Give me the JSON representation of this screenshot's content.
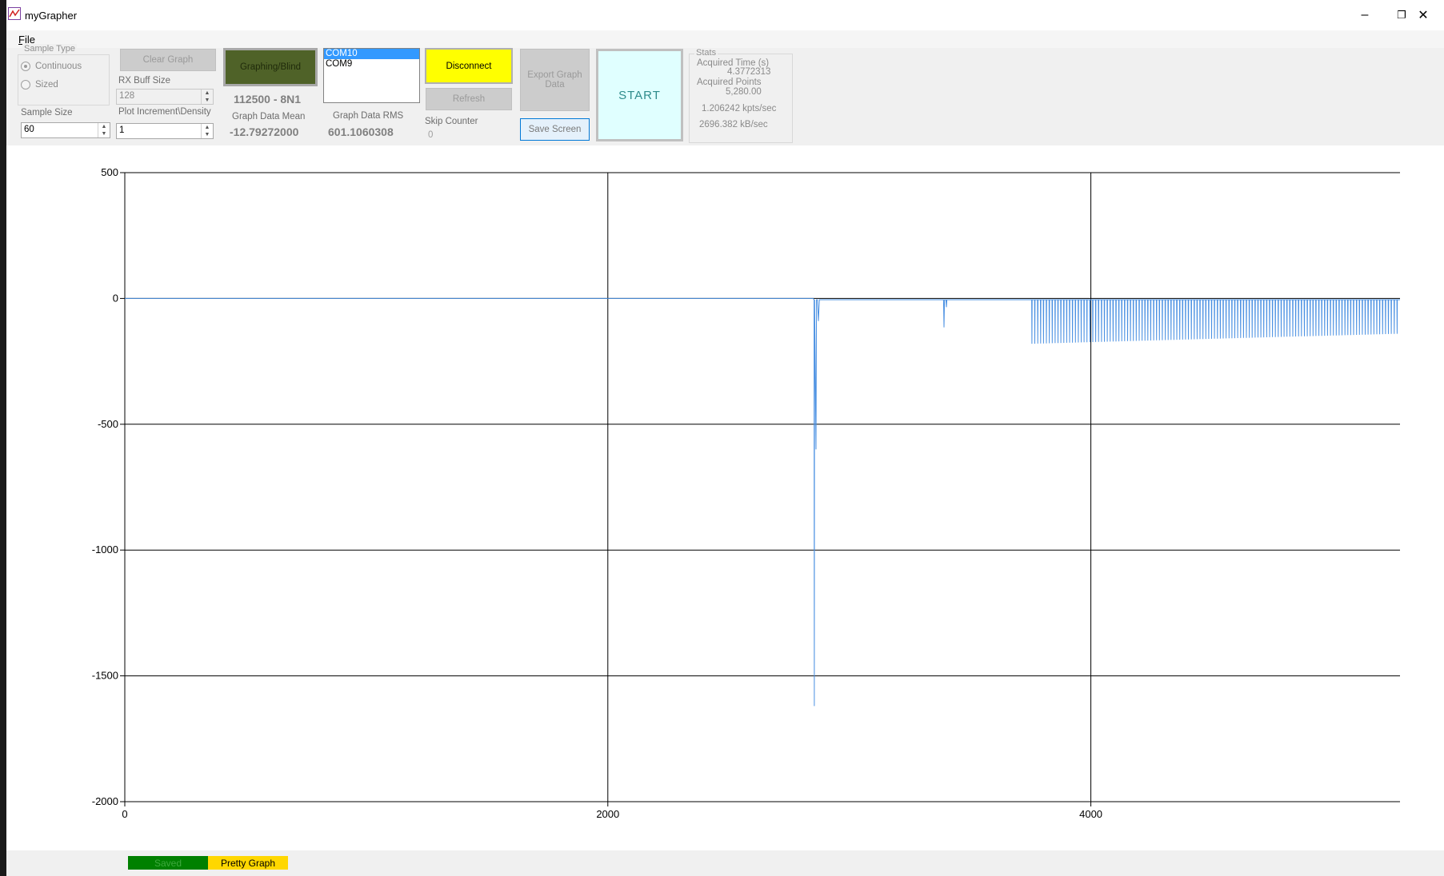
{
  "window": {
    "title": "myGrapher",
    "controls": {
      "minimize": "–",
      "restore": "❐",
      "close": "✕"
    }
  },
  "menu": {
    "file_label": "File"
  },
  "sample_type": {
    "legend": "Sample Type",
    "options": [
      "Continuous",
      "Sized"
    ],
    "selected": "Continuous"
  },
  "sample_size": {
    "label": "Sample Size",
    "value": "60"
  },
  "clear_graph": {
    "label": "Clear Graph"
  },
  "rx_buff": {
    "label": "RX Buff Size",
    "value": "128"
  },
  "plot_increment": {
    "label": "Plot Increment\\Density",
    "value": "1"
  },
  "graphing_blind": {
    "label": "Graphing/Blind",
    "color": "#4f6228"
  },
  "serial_config": "112500 - 8N1",
  "graph_mean": {
    "label": "Graph Data Mean",
    "value": "-12.79272000"
  },
  "graph_rms": {
    "label": "Graph Data RMS",
    "value": "601.1060308"
  },
  "ports": {
    "items": [
      "COM10",
      "COM9"
    ],
    "selected": "COM10"
  },
  "disconnect": {
    "label": "Disconnect",
    "color": "#ffff00"
  },
  "refresh": {
    "label": "Refresh"
  },
  "skip_counter": {
    "label": "Skip Counter",
    "value": "0"
  },
  "export": {
    "label": "Export Graph Data"
  },
  "save_screen": {
    "label": "Save Screen"
  },
  "start": {
    "label": "START",
    "color": "#e0ffff",
    "text_color": "#2e8b8b"
  },
  "stats": {
    "legend": "Stats",
    "acquired_time_label": "Acquired Time (s)",
    "acquired_time_value": "4.3772313",
    "acquired_points_label": "Acquired Points",
    "acquired_points_value": "5,280.00",
    "kpts_rate": "1.206242 kpts/sec",
    "kb_rate": "2696.382 kB/sec"
  },
  "chart_data": {
    "type": "line",
    "title": "",
    "xlabel": "",
    "ylabel": "",
    "xlim": [
      0,
      5280
    ],
    "ylim": [
      -2000,
      500
    ],
    "x_ticks": [
      0,
      2000,
      4000
    ],
    "y_ticks": [
      500,
      0,
      -500,
      -1000,
      -1500,
      -2000
    ],
    "grid": true,
    "series_color": "#4a90e2",
    "series": [
      {
        "description_points": [
          [
            0,
            0
          ],
          [
            2850,
            0
          ],
          [
            2854,
            -5
          ],
          [
            2855,
            -1620
          ],
          [
            2856,
            -5
          ],
          [
            2862,
            -600
          ],
          [
            2864,
            -5
          ],
          [
            2868,
            -5
          ],
          [
            2872,
            -90
          ],
          [
            2876,
            -5
          ],
          [
            3390,
            -5
          ],
          [
            3392,
            -115
          ],
          [
            3394,
            -5
          ],
          [
            3400,
            -5
          ],
          [
            3402,
            -35
          ],
          [
            3404,
            -5
          ],
          [
            3755,
            -5
          ],
          [
            3758,
            -180
          ],
          [
            5270,
            -140
          ],
          [
            5280,
            -5
          ]
        ],
        "dense_spike_region": {
          "x_start": 3755,
          "x_end": 5280,
          "spike_spacing": 12,
          "spike_min": -180,
          "spike_min_end": -140,
          "baseline": -5
        }
      }
    ]
  },
  "status": {
    "saved": {
      "label": "Saved",
      "color": "#008000",
      "text_color": "#3fa83f"
    },
    "pretty_graph": {
      "label": "Pretty Graph",
      "color": "#ffd700"
    }
  }
}
